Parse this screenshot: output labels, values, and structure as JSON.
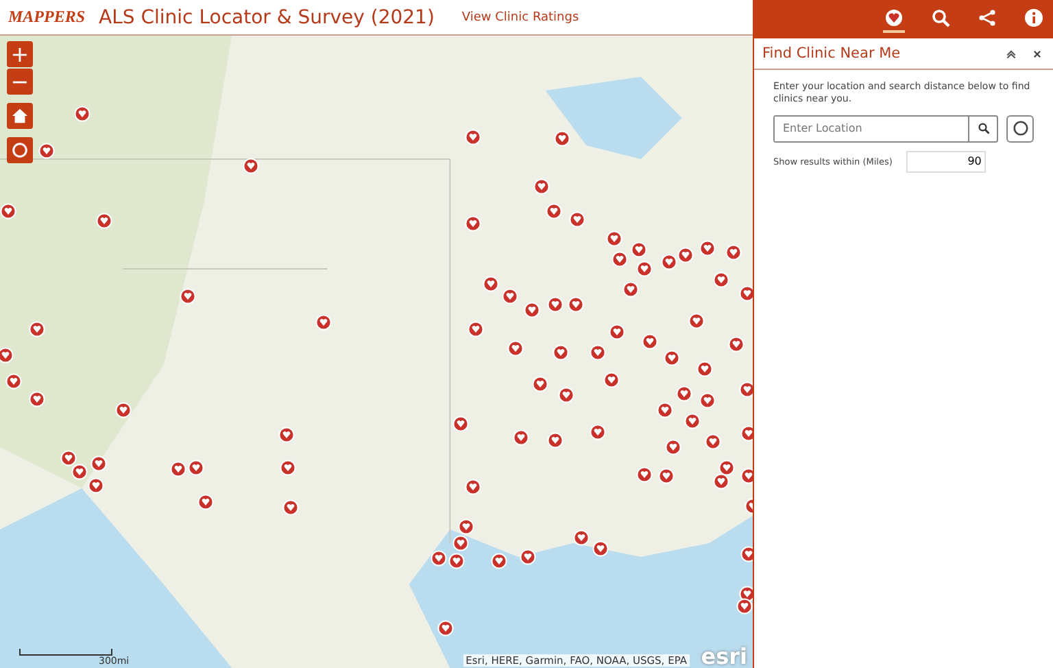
{
  "header": {
    "logo": "MAPPERS",
    "title": "ALS Clinic Locator & Survey (2021)",
    "link": "View Clinic Ratings"
  },
  "map": {
    "scale_label": "300mi",
    "attribution": "Esri, HERE, Garmin, FAO, NOAA, USGS, EPA",
    "provider_logo": "esri"
  },
  "map_controls": [
    {
      "kind": "zoom-in",
      "label": "+"
    },
    {
      "kind": "zoom-out",
      "label": "−"
    },
    {
      "kind": "home"
    },
    {
      "kind": "locate"
    }
  ],
  "toolbar": [
    {
      "kind": "clinic",
      "selected": true
    },
    {
      "kind": "search",
      "selected": false
    },
    {
      "kind": "share",
      "selected": false
    },
    {
      "kind": "info",
      "selected": false
    }
  ],
  "panel": {
    "title": "Find Clinic Near Me",
    "instructions": "Enter your location and search distance below to find clinics near you.",
    "location_field": {
      "placeholder": "Enter Location"
    },
    "distance_label": "Show results within (Miles)",
    "distance_value": "90"
  }
}
